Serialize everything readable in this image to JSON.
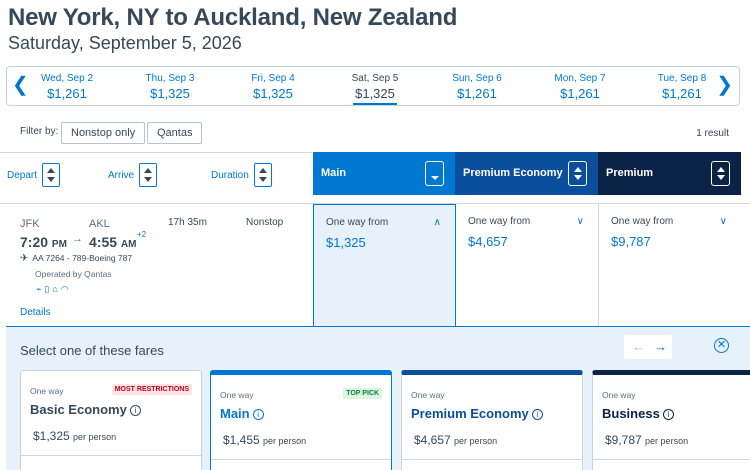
{
  "header": {
    "title": "New York, NY to Auckland, New Zealand",
    "date": "Saturday, September 5, 2026"
  },
  "dates": {
    "prev_icon": "chevron-left-icon",
    "next_icon": "chevron-right-icon",
    "items": [
      {
        "day": "Wed, Sep 2",
        "price": "$1,261",
        "selected": false
      },
      {
        "day": "Thu, Sep 3",
        "price": "$1,325",
        "selected": false
      },
      {
        "day": "Fri, Sep 4",
        "price": "$1,325",
        "selected": false
      },
      {
        "day": "Sat, Sep 5",
        "price": "$1,325",
        "selected": true
      },
      {
        "day": "Sun, Sep 6",
        "price": "$1,261",
        "selected": false
      },
      {
        "day": "Mon, Sep 7",
        "price": "$1,261",
        "selected": false
      },
      {
        "day": "Tue, Sep 8",
        "price": "$1,261",
        "selected": false
      }
    ]
  },
  "filters": {
    "label": "Filter by:",
    "chips": [
      "Nonstop only",
      "Qantas"
    ],
    "result_count": "1 result"
  },
  "sort": {
    "depart": "Depart",
    "arrive": "Arrive",
    "duration": "Duration"
  },
  "cabins": [
    {
      "label": "Main",
      "color": "#0078d2"
    },
    {
      "label": "Premium Economy",
      "color": "#0b4f9c"
    },
    {
      "label": "Premium",
      "color": "#0a2346"
    }
  ],
  "flight": {
    "origin": "JFK",
    "destination": "AKL",
    "depart_time": "7:20",
    "depart_ampm": "PM",
    "arrive_time": "4:55",
    "arrive_ampm": "AM",
    "day_offset": "+2",
    "duration": "17h 35m",
    "stops": "Nonstop",
    "flight_info": "AA 7264 - 789-Boeing 787",
    "operated_by": "Operated by Qantas",
    "details_link": "Details",
    "fares": [
      {
        "label": "One way from",
        "price": "$1,325"
      },
      {
        "label": "One way from",
        "price": "$4,657"
      },
      {
        "label": "One way from",
        "price": "$9,787"
      }
    ]
  },
  "fare_panel": {
    "title": "Select one of these fares",
    "cards": [
      {
        "trip": "One way",
        "badge": "MOST RESTRICTIONS",
        "name": "Basic Economy",
        "price": "$1,325",
        "unit": "per person",
        "accent": "#ffffff",
        "badge_bg": "#fde3e6",
        "badge_fg": "#c30019",
        "name_color": "#36495a"
      },
      {
        "trip": "One way",
        "badge": "TOP PICK",
        "name": "Main",
        "price": "$1,455",
        "unit": "per person",
        "accent": "#0078d2",
        "badge_bg": "#dff3e2",
        "badge_fg": "#00883a",
        "name_color": "#0078d2"
      },
      {
        "trip": "One way",
        "badge": "",
        "name": "Premium Economy",
        "price": "$4,657",
        "unit": "per person",
        "accent": "#0b4f9c",
        "badge_bg": "",
        "badge_fg": "",
        "name_color": "#0b4f9c"
      },
      {
        "trip": "One way",
        "badge": "",
        "name": "Business",
        "price": "$9,787",
        "unit": "per person",
        "accent": "#0a2346",
        "badge_bg": "",
        "badge_fg": "",
        "name_color": "#0a2346"
      }
    ]
  }
}
